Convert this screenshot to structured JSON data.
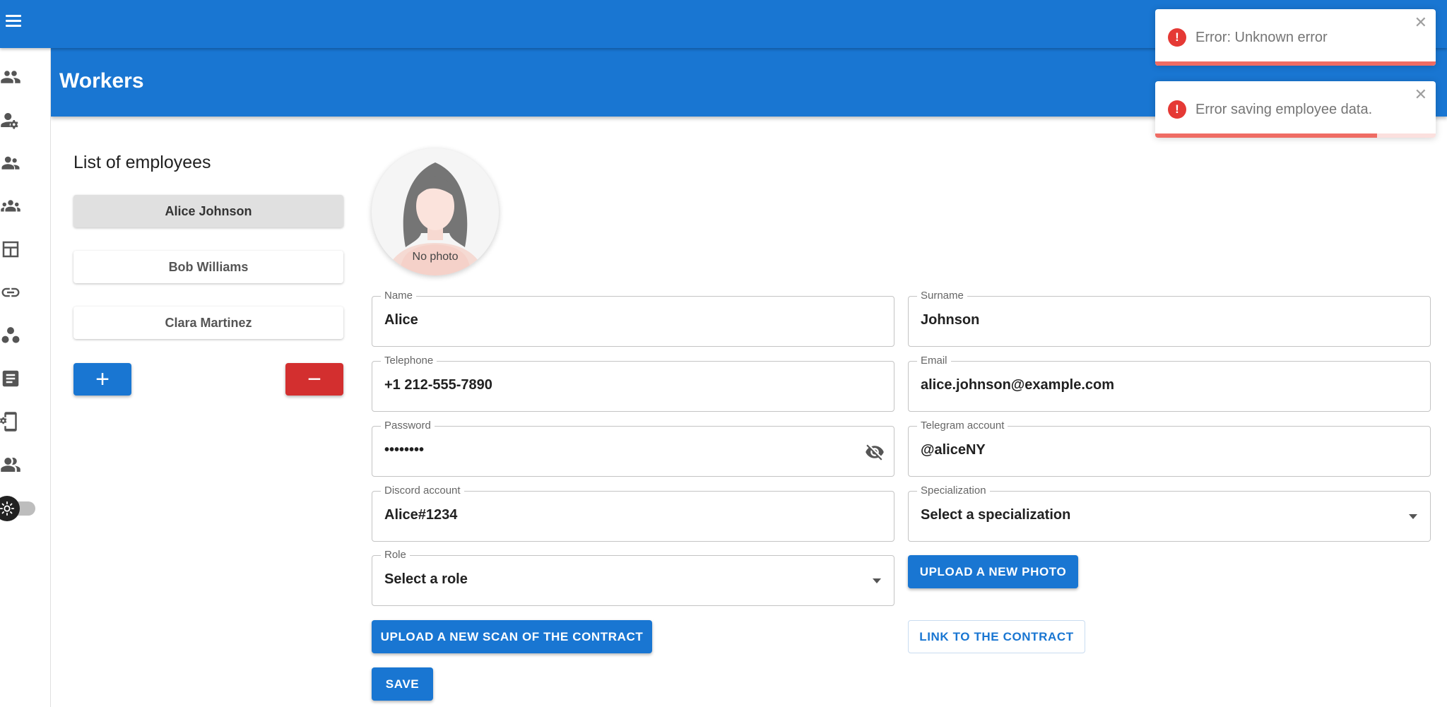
{
  "header": {
    "title": "Workers"
  },
  "sidebar": {
    "items": [
      {
        "icon": "group-icon"
      },
      {
        "icon": "worker-settings-icon"
      },
      {
        "icon": "people-icon"
      },
      {
        "icon": "groups-icon"
      },
      {
        "icon": "dashboard-layout-icon"
      },
      {
        "icon": "link-icon"
      },
      {
        "icon": "workspaces-icon"
      },
      {
        "icon": "article-icon"
      },
      {
        "icon": "device-settings-icon"
      },
      {
        "icon": "people-alt-icon"
      }
    ],
    "theme_toggle": {
      "icon": "sun-icon",
      "enabled": false
    }
  },
  "employees": {
    "title": "List of employees",
    "items": [
      {
        "name": "Alice Johnson",
        "selected": true
      },
      {
        "name": "Bob Williams",
        "selected": false
      },
      {
        "name": "Clara Martinez",
        "selected": false
      }
    ],
    "add_label": "+",
    "remove_label": "−"
  },
  "profile": {
    "photo_caption": "No photo",
    "fields": {
      "name": {
        "label": "Name",
        "value": "Alice"
      },
      "surname": {
        "label": "Surname",
        "value": "Johnson"
      },
      "telephone": {
        "label": "Telephone",
        "value": "+1 212-555-7890"
      },
      "email": {
        "label": "Email",
        "value": "alice.johnson@example.com"
      },
      "password": {
        "label": "Password",
        "value": "••••••••"
      },
      "telegram": {
        "label": "Telegram account",
        "value": "@aliceNY"
      },
      "discord": {
        "label": "Discord account",
        "value": "Alice#1234"
      },
      "specialization": {
        "label": "Specialization",
        "value": "Select a specialization"
      },
      "role": {
        "label": "Role",
        "value": "Select a role"
      }
    },
    "upload_photo_label": "UPLOAD A NEW PHOTO",
    "upload_contract_label": "UPLOAD A NEW SCAN OF THE CONTRACT",
    "contract_link_label": "LINK TO THE CONTRACT",
    "save_label": "SAVE"
  },
  "toasts": [
    {
      "message": "Error: Unknown error",
      "progress": 1.0
    },
    {
      "message": "Error saving employee data.",
      "progress": 0.79
    }
  ],
  "colors": {
    "primary": "#1976d2",
    "danger": "#d32f2f",
    "error": "#e53935"
  }
}
